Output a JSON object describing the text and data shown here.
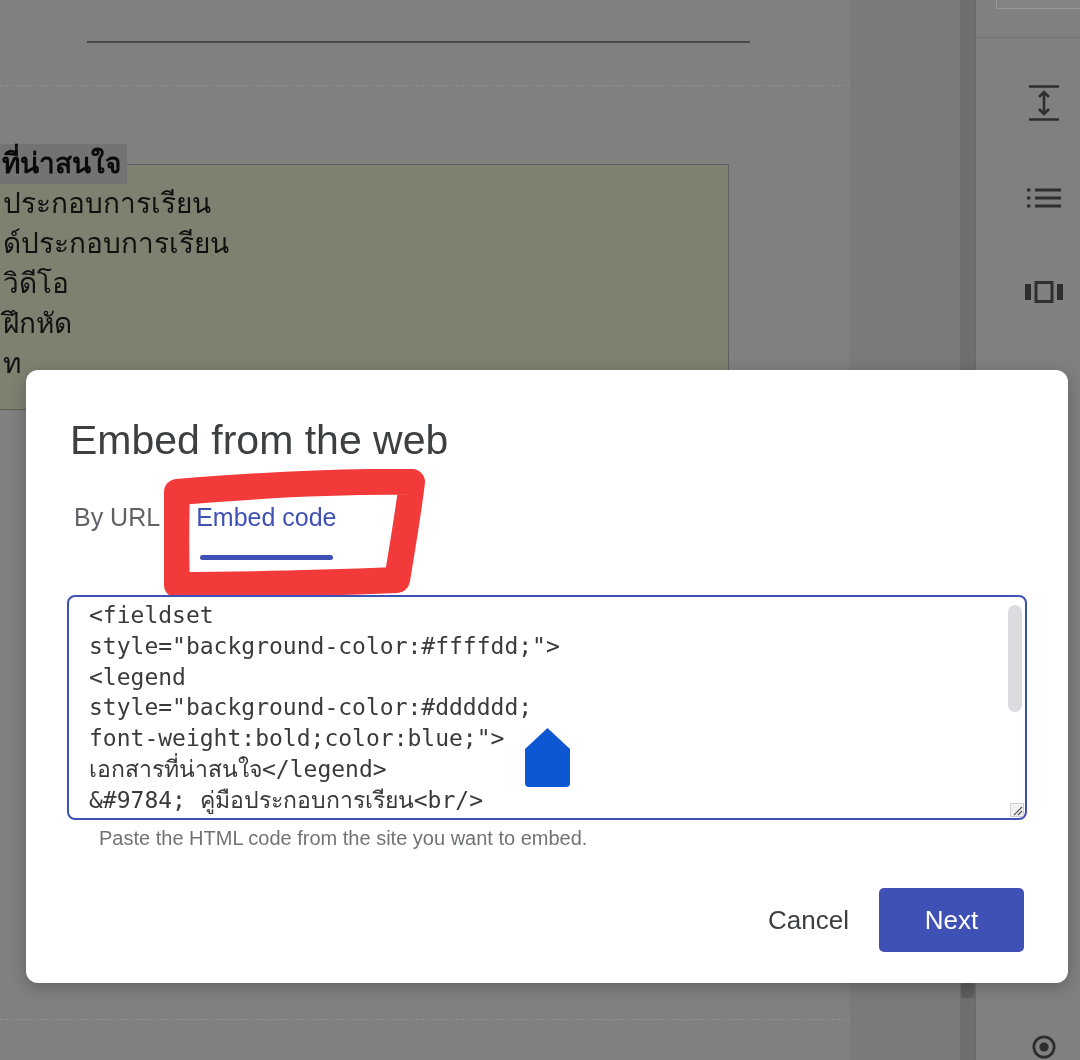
{
  "document": {
    "legend": "ที่น่าสนใจ",
    "lines": [
      "ประกอบการเรียน",
      "ด์ประกอบการเรียน",
      "วิดีโอ",
      "ฝึกหัด",
      "ท"
    ]
  },
  "dialog": {
    "title": "Embed from the web",
    "tabs": [
      {
        "label": "By URL",
        "selected": false
      },
      {
        "label": "Embed code",
        "selected": true
      }
    ],
    "code_field": {
      "value": "<fieldset\nstyle=\"background-color:#ffffdd;\">\n<legend\nstyle=\"background-color:#dddddd;\nfont-weight:bold;color:blue;\">\nเอกสารที่น่าสนใจ</legend>\n&#9784; คู่มือประกอบการเรียน<br/>"
    },
    "hint": "Paste the HTML code from the site you want to embed.",
    "buttons": [
      {
        "label": "Cancel",
        "kind": "text"
      },
      {
        "label": "Next",
        "kind": "primary"
      }
    ]
  }
}
